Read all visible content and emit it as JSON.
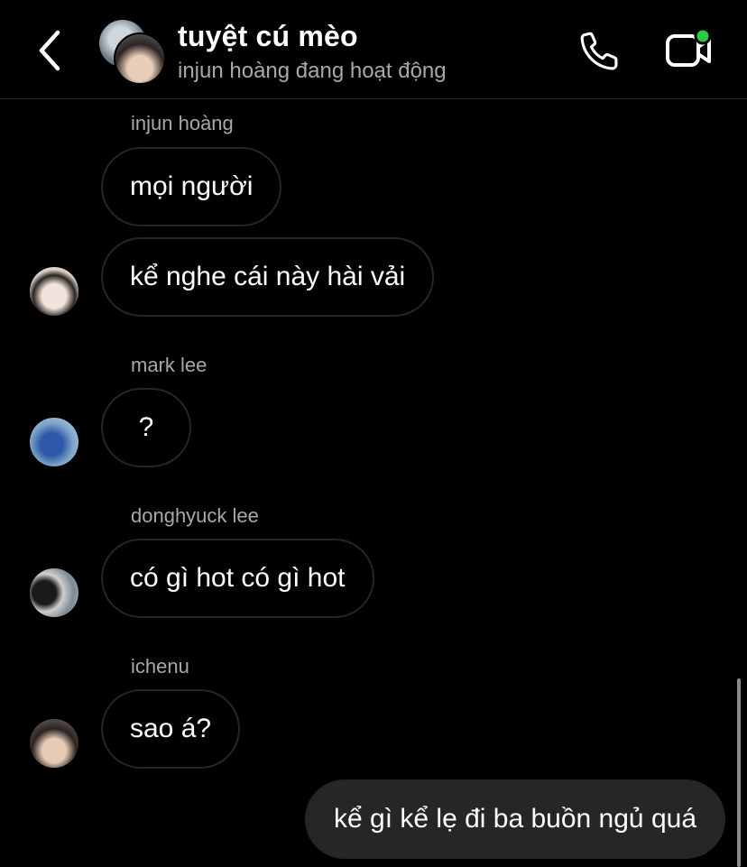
{
  "header": {
    "title": "tuyệt cú mèo",
    "status": "injun hoàng đang hoạt động",
    "back_icon": "chevron-left-icon",
    "call_icon": "phone-icon",
    "video_icon": "video-camera-icon",
    "online_color": "#2ec846"
  },
  "messages": [
    {
      "sender": "injun hoàng",
      "bubbles": [
        "mọi người",
        "kể nghe cái này hài vải"
      ]
    },
    {
      "sender": "mark lee",
      "bubbles": [
        "?"
      ]
    },
    {
      "sender": "donghyuck lee",
      "bubbles": [
        "có gì hot có gì hot"
      ]
    },
    {
      "sender": "ichenu",
      "bubbles": [
        "sao á?"
      ]
    }
  ],
  "outgoing": {
    "text": "kể gì kể lẹ đi ba buồn ngủ quá"
  },
  "colors": {
    "background": "#000000",
    "bubble_border": "#262626",
    "outgoing_bubble": "#262626",
    "secondary_text": "#a8a8a8"
  }
}
